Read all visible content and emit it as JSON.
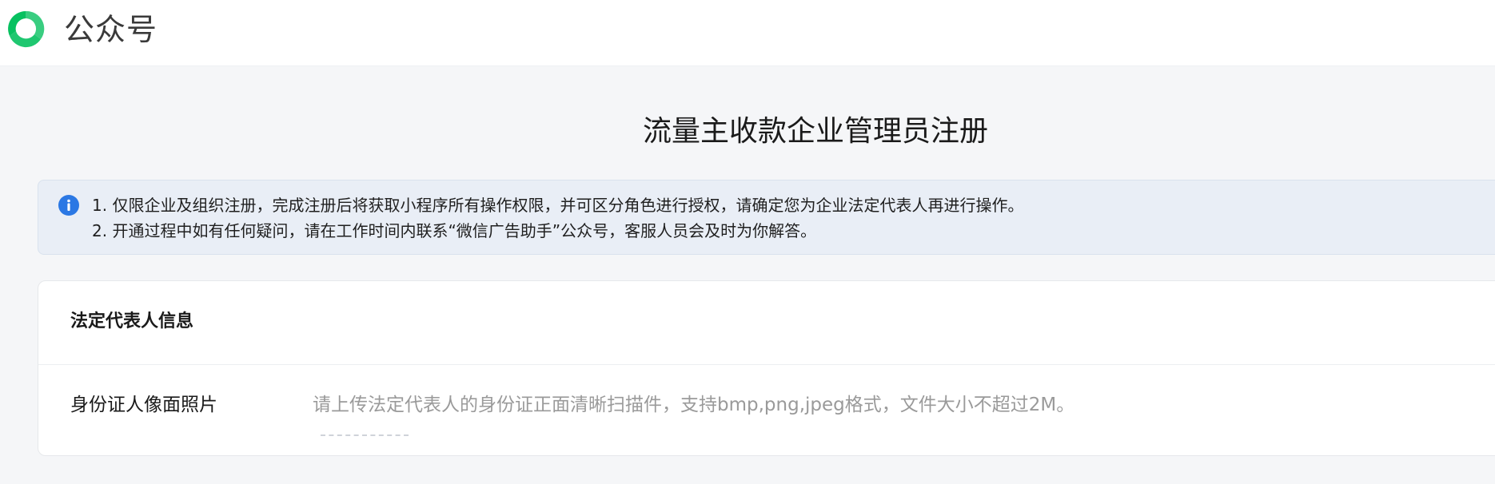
{
  "header": {
    "brand": "公众号",
    "logo_icon": "wechat-official-account-logo-icon",
    "brand_color": "#07c160"
  },
  "page": {
    "title": "流量主收款企业管理员注册"
  },
  "notice": {
    "icon": "info-icon",
    "icon_color": "#2b78e4",
    "lines": [
      "1. 仅限企业及组织注册，完成注册后将获取小程序所有操作权限，并可区分角色进行授权，请确定您为企业法定代表人再进行操作。",
      "2. 开通过程中如有任何疑问，请在工作时间内联系“微信广告助手”公众号，客服人员会及时为你解答。"
    ]
  },
  "legal_rep_section": {
    "title": "法定代表人信息",
    "fields": [
      {
        "label": "身份证人像面照片",
        "hint": "请上传法定代表人的身份证正面清晰扫描件，支持bmp,png,jpeg格式，文件大小不超过2M。"
      }
    ]
  }
}
